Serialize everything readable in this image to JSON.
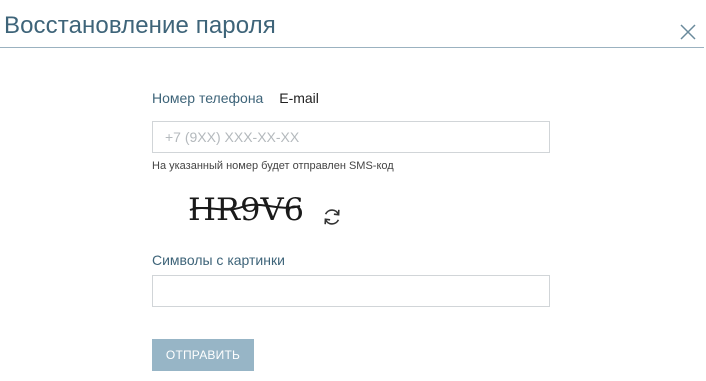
{
  "dialog": {
    "title": "Восстановление пароля",
    "close_icon": "close-icon"
  },
  "tabs": [
    {
      "label": "Номер телефона",
      "active": true
    },
    {
      "label": "E-mail",
      "active": false
    }
  ],
  "phone": {
    "placeholder": "+7 (9XX) XXX-XX-XX",
    "value": "",
    "hint": "На указанный номер будет отправлен SMS-код"
  },
  "captcha": {
    "text": "HR9V6",
    "refresh_icon": "refresh-icon"
  },
  "captcha_field": {
    "label": "Символы с картинки",
    "value": ""
  },
  "submit": {
    "label": "ОТПРАВИТЬ"
  },
  "colors": {
    "title": "#3e6479",
    "button": "#97b5c6",
    "border": "#d1d5d8"
  }
}
